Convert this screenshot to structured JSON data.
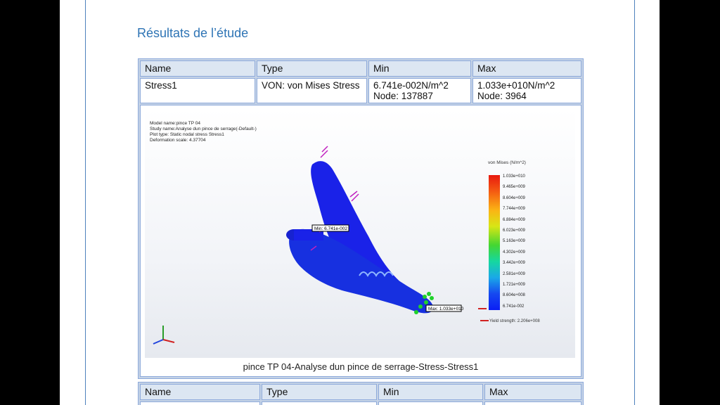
{
  "heading": "Résultats de l’étude",
  "table1": {
    "headers": [
      "Name",
      "Type",
      "Min",
      "Max"
    ],
    "row": {
      "name": "Stress1",
      "type": "VON: von Mises Stress",
      "min_value": "6.741e-002N/m^2",
      "min_node": "Node: 137887",
      "max_value": "1.033e+010N/m^2",
      "max_node": "Node: 3964"
    }
  },
  "figure": {
    "meta": [
      "Model name:pince TP 04",
      "Study name:Analyse dun pince de serrage(-Default-)",
      "Plot type: Static nodal stress Stress1",
      "Deformation scale: 4.37704"
    ],
    "legend_title": "von Mises (N/m^2)",
    "ticks": [
      "1.033e+010",
      "9.465e+009",
      "8.604e+009",
      "7.744e+009",
      "6.884e+009",
      "6.023e+009",
      "5.163e+009",
      "4.302e+009",
      "3.442e+009",
      "2.581e+009",
      "1.721e+009",
      "8.604e+008",
      "6.741e-002"
    ],
    "yield": "Yield strength: 2.206e+008",
    "min_label": "Min: 6.741e-002",
    "max_label": "Max: 1.033e+010",
    "caption": "pince TP 04-Analyse dun pince de serrage-Stress-Stress1"
  },
  "table2": {
    "headers": [
      "Name",
      "Type",
      "Min",
      "Max"
    ]
  },
  "colors": {
    "heading": "#2e74b5",
    "header_bg": "#dce6f2",
    "border": "#8eaadb",
    "part": "#1a22e8"
  }
}
